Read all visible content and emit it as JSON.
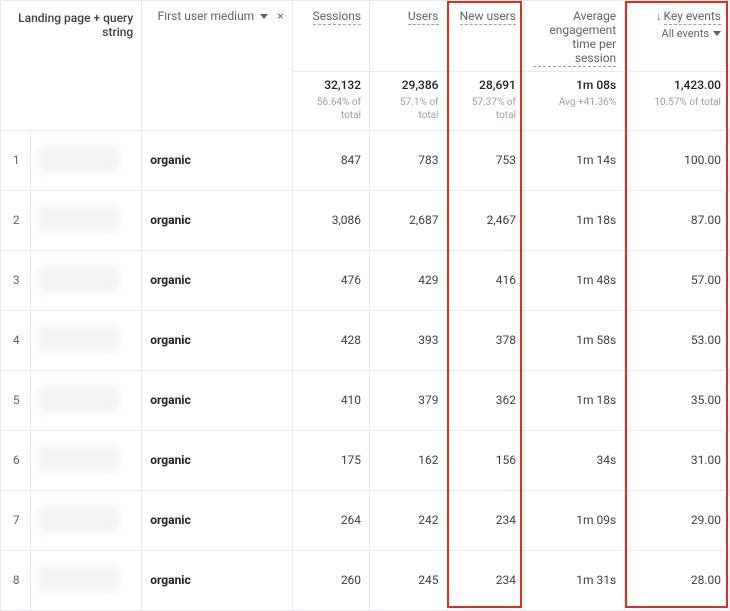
{
  "dims": {
    "primary_label": "Landing page + query string",
    "secondary_label": "First user medium",
    "close_glyph": "×"
  },
  "columns": {
    "sessions": "Sessions",
    "users": "Users",
    "new_users": "New users",
    "avg_eng": "Average engagement time per session",
    "key_events": "Key events",
    "key_events_filter": "All events"
  },
  "totals": {
    "sessions": {
      "value": "32,132",
      "sub": "56.64% of total"
    },
    "users": {
      "value": "29,386",
      "sub": "57.1% of total"
    },
    "new_users": {
      "value": "28,691",
      "sub": "57.37% of total"
    },
    "avg_eng": {
      "value": "1m 08s",
      "sub": "Avg +41.36%"
    },
    "key_events": {
      "value": "1,423.00",
      "sub": "10.57% of total"
    }
  },
  "rows": [
    {
      "idx": "1",
      "medium": "organic",
      "sessions": "847",
      "users": "783",
      "new_users": "753",
      "avg_eng": "1m 14s",
      "key_events": "100.00"
    },
    {
      "idx": "2",
      "medium": "organic",
      "sessions": "3,086",
      "users": "2,687",
      "new_users": "2,467",
      "avg_eng": "1m 18s",
      "key_events": "87.00"
    },
    {
      "idx": "3",
      "medium": "organic",
      "sessions": "476",
      "users": "429",
      "new_users": "416",
      "avg_eng": "1m 48s",
      "key_events": "57.00"
    },
    {
      "idx": "4",
      "medium": "organic",
      "sessions": "428",
      "users": "393",
      "new_users": "378",
      "avg_eng": "1m 58s",
      "key_events": "53.00"
    },
    {
      "idx": "5",
      "medium": "organic",
      "sessions": "410",
      "users": "379",
      "new_users": "362",
      "avg_eng": "1m 18s",
      "key_events": "35.00"
    },
    {
      "idx": "6",
      "medium": "organic",
      "sessions": "175",
      "users": "162",
      "new_users": "156",
      "avg_eng": "34s",
      "key_events": "31.00"
    },
    {
      "idx": "7",
      "medium": "organic",
      "sessions": "264",
      "users": "242",
      "new_users": "234",
      "avg_eng": "1m 09s",
      "key_events": "29.00"
    },
    {
      "idx": "8",
      "medium": "organic",
      "sessions": "260",
      "users": "245",
      "new_users": "234",
      "avg_eng": "1m 31s",
      "key_events": "28.00"
    }
  ]
}
